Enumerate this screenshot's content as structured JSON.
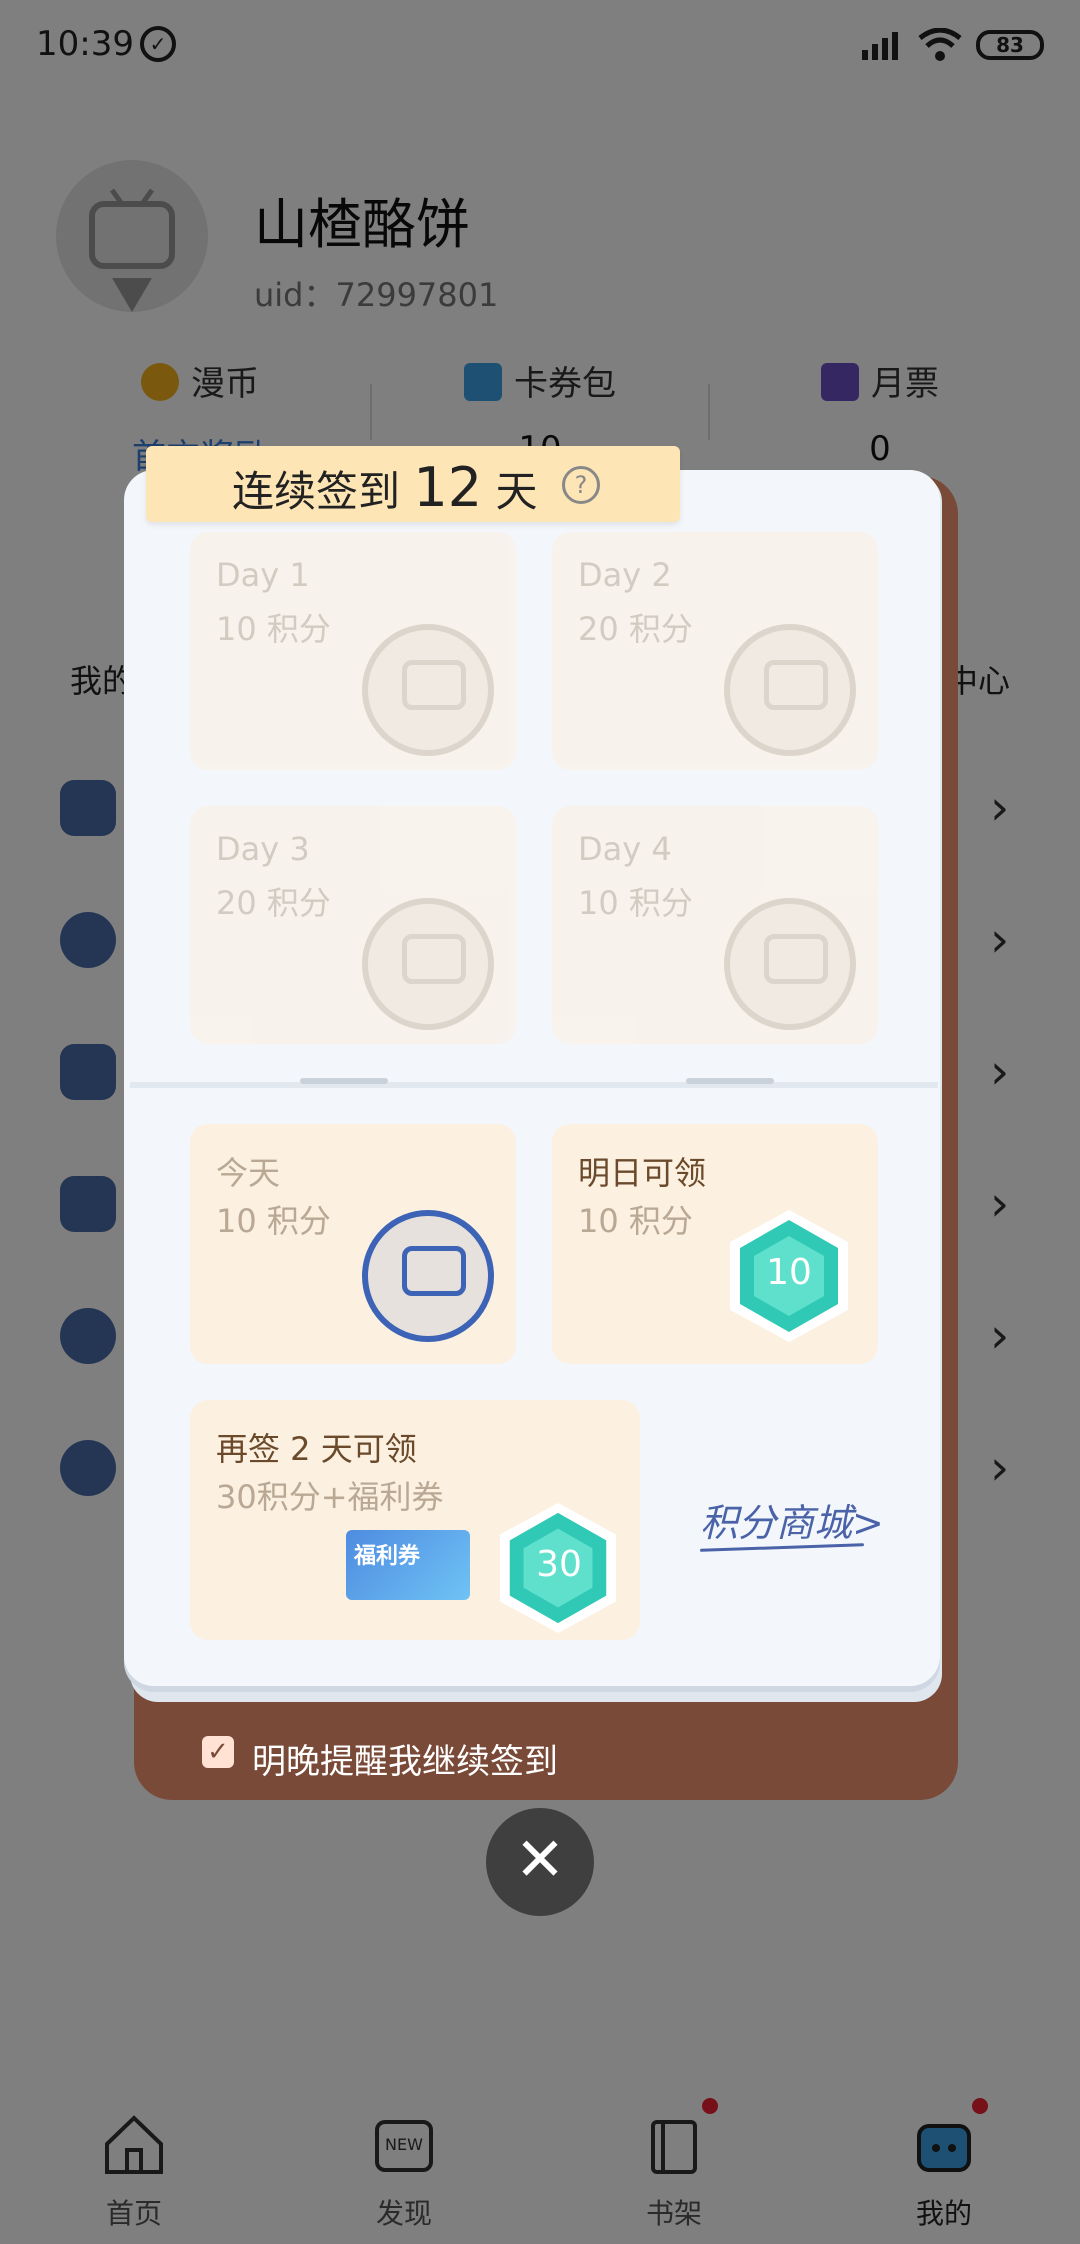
{
  "status_bar": {
    "time": "10:39",
    "battery": "83"
  },
  "profile": {
    "name": "山楂酪饼",
    "uid": "uid：72997801"
  },
  "stats": [
    {
      "label": "漫币",
      "value": "首充奖励",
      "icon": "coin-icon",
      "color": "#f5b01a"
    },
    {
      "label": "卡券包",
      "value": "10",
      "icon": "wallet-icon",
      "color": "#3aa0e6"
    },
    {
      "label": "月票",
      "value": "0",
      "icon": "ticket-icon",
      "color": "#6a4fc4"
    }
  ],
  "grid": {
    "left_label": "我的",
    "right_label": "中心"
  },
  "tabbar": [
    {
      "label": "首页",
      "icon": "home-icon"
    },
    {
      "label": "发现",
      "icon": "new-icon"
    },
    {
      "label": "书架",
      "icon": "bookshelf-icon"
    },
    {
      "label": "我的",
      "icon": "profile-icon"
    }
  ],
  "checkin": {
    "streak_prefix": "连续签到",
    "streak_days": "12",
    "streak_suffix": "天",
    "help": "?",
    "days": [
      {
        "title": "Day 1",
        "points": "10 积分"
      },
      {
        "title": "Day 2",
        "points": "20 积分"
      },
      {
        "title": "Day 3",
        "points": "20 积分"
      },
      {
        "title": "Day 4",
        "points": "10 积分"
      }
    ],
    "today": {
      "title": "今天",
      "points": "10 积分"
    },
    "tomorrow": {
      "title": "明日可领",
      "points": "10 积分",
      "gem_value": "10"
    },
    "bonus": {
      "title": "再签 2 天可领",
      "reward": "30积分+福利券",
      "gem_value": "30",
      "voucher_label": "福利券"
    },
    "mall_link": "积分商城>",
    "remind_checked": true,
    "remind_label": "明晚提醒我继续签到",
    "close": "✕"
  },
  "colors": {
    "book_cover": "#7a4a38",
    "banner": "#fde5b5",
    "card": "#fcf0e1",
    "gem": "#2fc9b6",
    "link": "#4a62a8"
  }
}
